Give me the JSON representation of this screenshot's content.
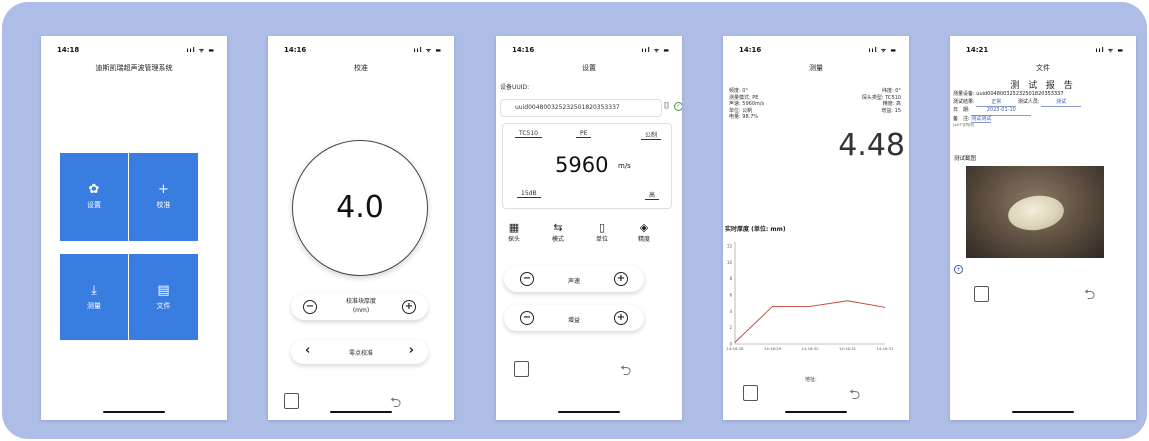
{
  "phone1": {
    "time": "14:18",
    "status_icons": "ııl ᯤ ▬",
    "title": "迪斯凯瑞超声波管理系统",
    "tiles": [
      {
        "icon": "✿",
        "label": "设置"
      },
      {
        "icon": "+",
        "label": "校准"
      },
      {
        "icon": "⤓",
        "label": "测量"
      },
      {
        "icon": "▤",
        "label": "文件"
      }
    ]
  },
  "phone2": {
    "time": "14:16",
    "status_icons": "ııl ᯤ ▬",
    "title": "校准",
    "value": "4.0",
    "thickness_label": "校准块厚度\n(mm)",
    "zero_label": "零点校准",
    "minus": "−",
    "plus": "+",
    "prev": "‹",
    "next": "›"
  },
  "phone3": {
    "time": "14:16",
    "status_icons": "ııl ᯤ ▬",
    "title": "设置",
    "uuid_label": "设备UUID:",
    "uuid_value": "uuid004800325232501820353337",
    "probe": "TC510",
    "mode": "PE",
    "unit": "公制",
    "velocity": "5960",
    "velocity_unit": "m/s",
    "gain": "15dB",
    "precision": "高",
    "tabs": [
      {
        "icon": "▦",
        "label": "探头"
      },
      {
        "icon": "⇆",
        "label": "模式"
      },
      {
        "icon": "▯",
        "label": "单位"
      },
      {
        "icon": "◈",
        "label": "精度"
      }
    ],
    "speed_label": "声速",
    "gain_label": "增益",
    "minus": "−",
    "plus": "+"
  },
  "phone4": {
    "time": "14:16",
    "status_icons": "ııl ᯤ ▬",
    "title": "测量",
    "left_info": [
      "频度: 0°",
      "测量模式: PE",
      "声速: 5960m/s",
      "单位: 公制",
      "电量: 98.7%"
    ],
    "right_info": [
      "纬度: 0°",
      "探头类型: TC510",
      "精度: 高",
      "增益: 15"
    ],
    "reading": "4.48",
    "chart_title": "实时厚度 (单位: mm)",
    "address_label": "地址:"
  },
  "phone5": {
    "time": "14:21",
    "status_icons": "ııl ᯤ ▬",
    "title": "文件",
    "report_title": "测 试 报 告",
    "device_label": "测量设备:",
    "device_value": "uuid004800325232501820353337",
    "result_label": "测试结果:",
    "result_value": "正常",
    "person_label": "测试人员:",
    "person_value": "测试",
    "date_label": "日　期:",
    "date_value": "2023-01-10",
    "remark_label": "备　注:",
    "remark_value": "测试测试",
    "remark_hint": "(40个字符内)",
    "screenshot_label": "测试截图"
  },
  "chart_data": {
    "type": "line",
    "title": "实时厚度 (单位: mm)",
    "x": [
      "14:16:28",
      "14:16:29",
      "14:16:30",
      "14:16:31",
      "14:16:31"
    ],
    "series": [
      {
        "values": [
          0.2,
          4.6,
          4.6,
          5.3,
          4.5
        ]
      }
    ],
    "xticks": [
      "14:16:28",
      "14:16:29",
      "14:16:30",
      "14:16:31",
      "14:16:31"
    ],
    "yticks": [
      0,
      2,
      4,
      6,
      8,
      10,
      12
    ],
    "ylim": [
      0,
      12.5
    ],
    "color": "#c0463a"
  }
}
